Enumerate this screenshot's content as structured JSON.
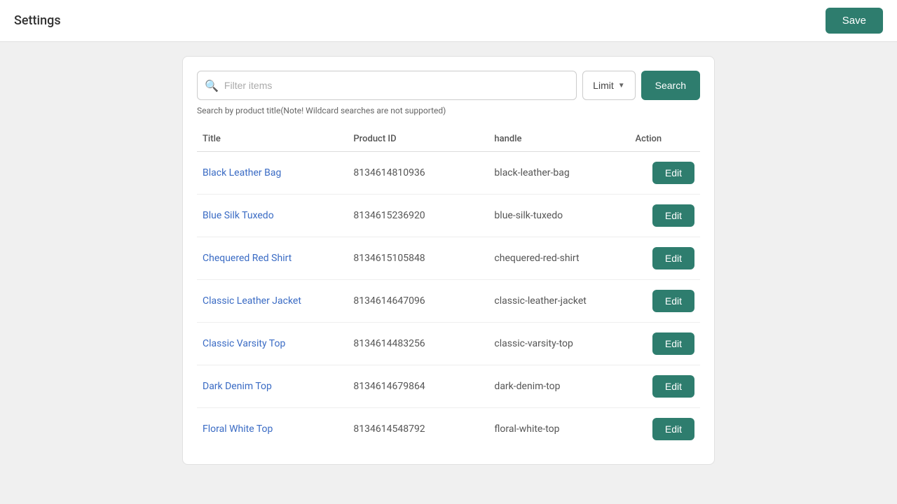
{
  "header": {
    "title": "Settings",
    "save_label": "Save"
  },
  "search": {
    "placeholder": "Filter items",
    "hint": "Search by product title(Note! Wildcard searches are not supported)",
    "limit_label": "Limit",
    "search_label": "Search"
  },
  "table": {
    "columns": [
      {
        "key": "title",
        "label": "Title"
      },
      {
        "key": "product_id",
        "label": "Product ID"
      },
      {
        "key": "handle",
        "label": "handle"
      },
      {
        "key": "action",
        "label": "Action"
      }
    ],
    "rows": [
      {
        "title": "Black Leather Bag",
        "product_id": "8134614810936",
        "handle": "black-leather-bag",
        "edit_label": "Edit"
      },
      {
        "title": "Blue Silk Tuxedo",
        "product_id": "8134615236920",
        "handle": "blue-silk-tuxedo",
        "edit_label": "Edit"
      },
      {
        "title": "Chequered Red Shirt",
        "product_id": "8134615105848",
        "handle": "chequered-red-shirt",
        "edit_label": "Edit"
      },
      {
        "title": "Classic Leather Jacket",
        "product_id": "8134614647096",
        "handle": "classic-leather-jacket",
        "edit_label": "Edit"
      },
      {
        "title": "Classic Varsity Top",
        "product_id": "8134614483256",
        "handle": "classic-varsity-top",
        "edit_label": "Edit"
      },
      {
        "title": "Dark Denim Top",
        "product_id": "8134614679864",
        "handle": "dark-denim-top",
        "edit_label": "Edit"
      },
      {
        "title": "Floral White Top",
        "product_id": "8134614548792",
        "handle": "floral-white-top",
        "edit_label": "Edit"
      }
    ]
  }
}
